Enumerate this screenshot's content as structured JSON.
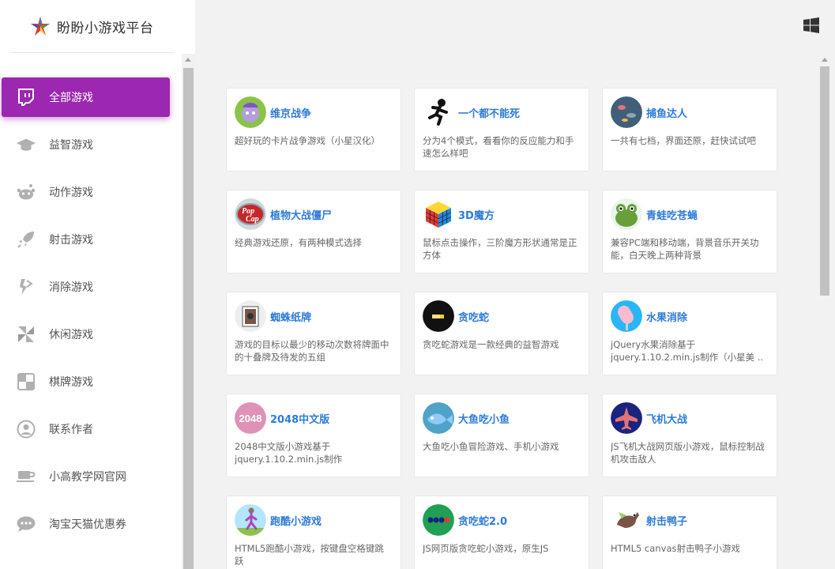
{
  "brand": {
    "title": "盼盼小游戏平台",
    "logo_icon": "star-logo-icon"
  },
  "header": {
    "windows_icon": "windows-icon"
  },
  "sidebar": {
    "items": [
      {
        "label": "全部游戏",
        "icon": "twitch-icon",
        "active": true
      },
      {
        "label": "益智游戏",
        "icon": "graduation-cap-icon"
      },
      {
        "label": "动作游戏",
        "icon": "reddit-icon"
      },
      {
        "label": "射击游戏",
        "icon": "rocket-icon"
      },
      {
        "label": "消除游戏",
        "icon": "code-icon"
      },
      {
        "label": "休闲游戏",
        "icon": "pinwheel-icon"
      },
      {
        "label": "棋牌游戏",
        "icon": "checkerboard-icon"
      },
      {
        "label": "联系作者",
        "icon": "user-circle-icon"
      },
      {
        "label": "小高教学网官网",
        "icon": "coffee-icon"
      },
      {
        "label": "淘宝天猫优惠券",
        "icon": "chat-bubble-icon"
      }
    ]
  },
  "games": [
    {
      "title": "维京战争",
      "desc": "超好玩的卡片战争游戏（小星汉化）",
      "thumb": "viking-war-thumb"
    },
    {
      "title": "一个都不能死",
      "desc": "分为4个模式，看看你的反应能力和手速怎么样吧",
      "thumb": "running-man-thumb"
    },
    {
      "title": "捕鱼达人",
      "desc": "一共有七档，界面还原，赶快试试吧",
      "thumb": "fishing-thumb"
    },
    {
      "title": "植物大战僵尸",
      "desc": "经典游戏还原，有两种模式选择",
      "thumb": "popcap-thumb"
    },
    {
      "title": "3D魔方",
      "desc": "鼠标点击操作，三阶魔方形状通常是正方体",
      "thumb": "rubik-cube-thumb"
    },
    {
      "title": "青蛙吃苍蝇",
      "desc": "兼容PC端和移动端，背景音乐开关功能，白天晚上两种背景",
      "thumb": "frog-thumb"
    },
    {
      "title": "蜘蛛纸牌",
      "desc": "游戏的目标以最少的移动次数将牌面中的十叠牌及待发的五组",
      "thumb": "spider-cards-thumb"
    },
    {
      "title": "贪吃蛇",
      "desc": "贪吃蛇游戏是一款经典的益智游戏",
      "thumb": "snake-thumb"
    },
    {
      "title": "水果消除",
      "desc": "jQuery水果消除基于jquery.1.10.2.min.js制作（小星美 ..",
      "thumb": "fruit-thumb"
    },
    {
      "title": "2048中文版",
      "desc": "2048中文版小游戏基于jquery.1.10.2.min.js制作",
      "thumb": "game-2048-thumb",
      "thumb_text": "2048"
    },
    {
      "title": "大鱼吃小鱼",
      "desc": "大鱼吃小鱼冒险游戏、手机小游戏",
      "thumb": "big-fish-thumb"
    },
    {
      "title": "飞机大战",
      "desc": "JS飞机大战网页版小游戏，鼠标控制战机攻击敌人",
      "thumb": "plane-war-thumb"
    },
    {
      "title": "跑酷小游戏",
      "desc": "HTML5跑酷小游戏，按键盘空格键跳跃",
      "thumb": "parkour-thumb"
    },
    {
      "title": "贪吃蛇2.0",
      "desc": "JS网页版贪吃蛇小游戏，原生JS",
      "thumb": "snake2-thumb"
    },
    {
      "title": "射击鸭子",
      "desc": "HTML5 canvas射击鸭子小游戏",
      "thumb": "duck-hunt-thumb"
    }
  ],
  "colors": {
    "accent": "#9c27b0",
    "title_link": "#2d7bd6",
    "background": "#f2f2f2"
  }
}
